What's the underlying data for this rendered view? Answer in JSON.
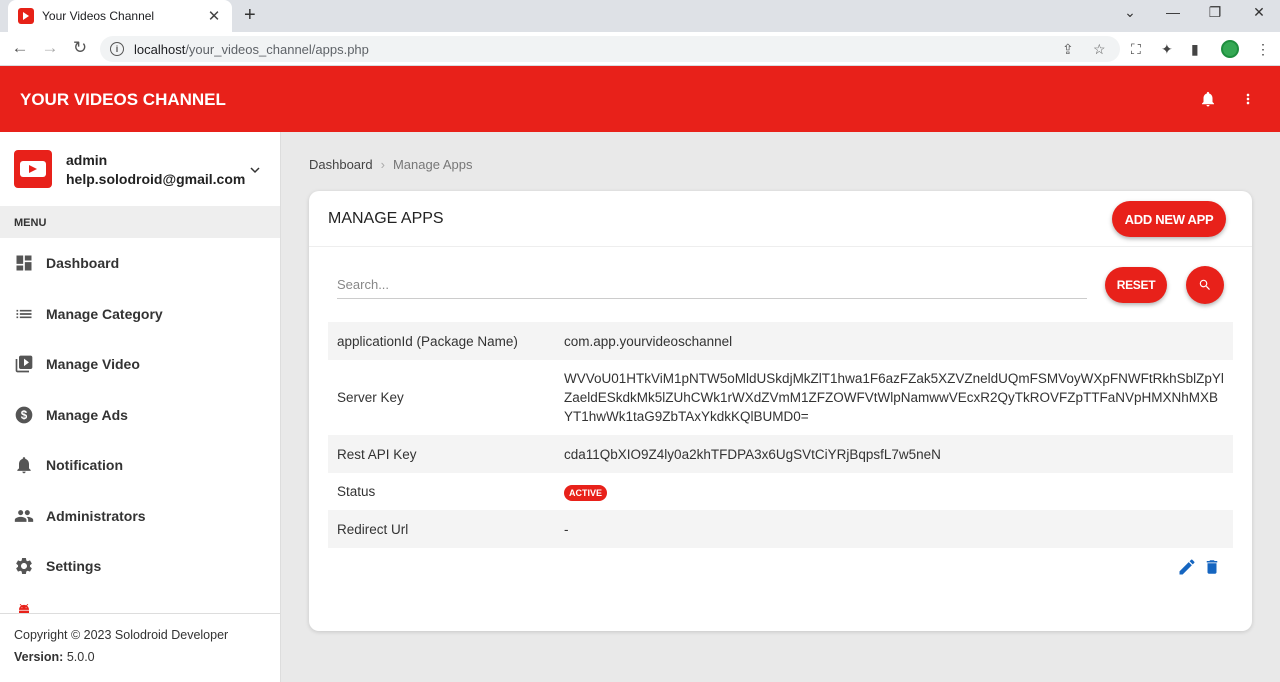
{
  "browser": {
    "tab_title": "Your Videos Channel",
    "url_host": "localhost",
    "url_path": "/your_videos_channel/apps.php"
  },
  "header": {
    "title": "YOUR VIDEOS CHANNEL"
  },
  "user": {
    "name": "admin",
    "email": "help.solodroid@gmail.com"
  },
  "sidebar": {
    "menu_header": "MENU",
    "items": [
      {
        "label": "Dashboard",
        "icon": "dashboard-icon"
      },
      {
        "label": "Manage Category",
        "icon": "list-icon"
      },
      {
        "label": "Manage Video",
        "icon": "video-library-icon"
      },
      {
        "label": "Manage Ads",
        "icon": "dollar-icon"
      },
      {
        "label": "Notification",
        "icon": "bell-icon"
      },
      {
        "label": "Administrators",
        "icon": "people-icon"
      },
      {
        "label": "Settings",
        "icon": "gear-icon"
      }
    ],
    "copyright": "Copyright © 2023 Solodroid Developer",
    "version_label": "Version:",
    "version_value": "5.0.0"
  },
  "breadcrumb": {
    "home": "Dashboard",
    "current": "Manage Apps"
  },
  "card": {
    "title": "MANAGE APPS",
    "add_button": "ADD NEW APP",
    "search_placeholder": "Search...",
    "reset_button": "RESET"
  },
  "app_details": [
    {
      "label": "applicationId (Package Name)",
      "value": "com.app.yourvideoschannel"
    },
    {
      "label": "Server Key",
      "value": "WVVoU01HTkViM1pNTW5oMldUSkdjMkZlT1hwa1F6azFZak5XZVZneldUQmFSMVoyWXpFNWFtRkhSblZpYlZaeldESkdkMk5lZUhCWk1rWXdZVmM1ZFZOWFVtWlpNamwwVEcxR2QyTkROVFZpTTFaNVpHMXNhMXBYT1hwWk1taG9ZbTAxYkdkKQlBUMD0="
    },
    {
      "label": "Rest API Key",
      "value": "cda11QbXIO9Z4ly0a2khTFDPA3x6UgSVtCiYRjBqpsfL7w5neN"
    },
    {
      "label": "Status",
      "value": "ACTIVE"
    },
    {
      "label": "Redirect Url",
      "value": "-"
    }
  ],
  "colors": {
    "brand_red": "#e8211a",
    "action_blue": "#1565c0"
  }
}
